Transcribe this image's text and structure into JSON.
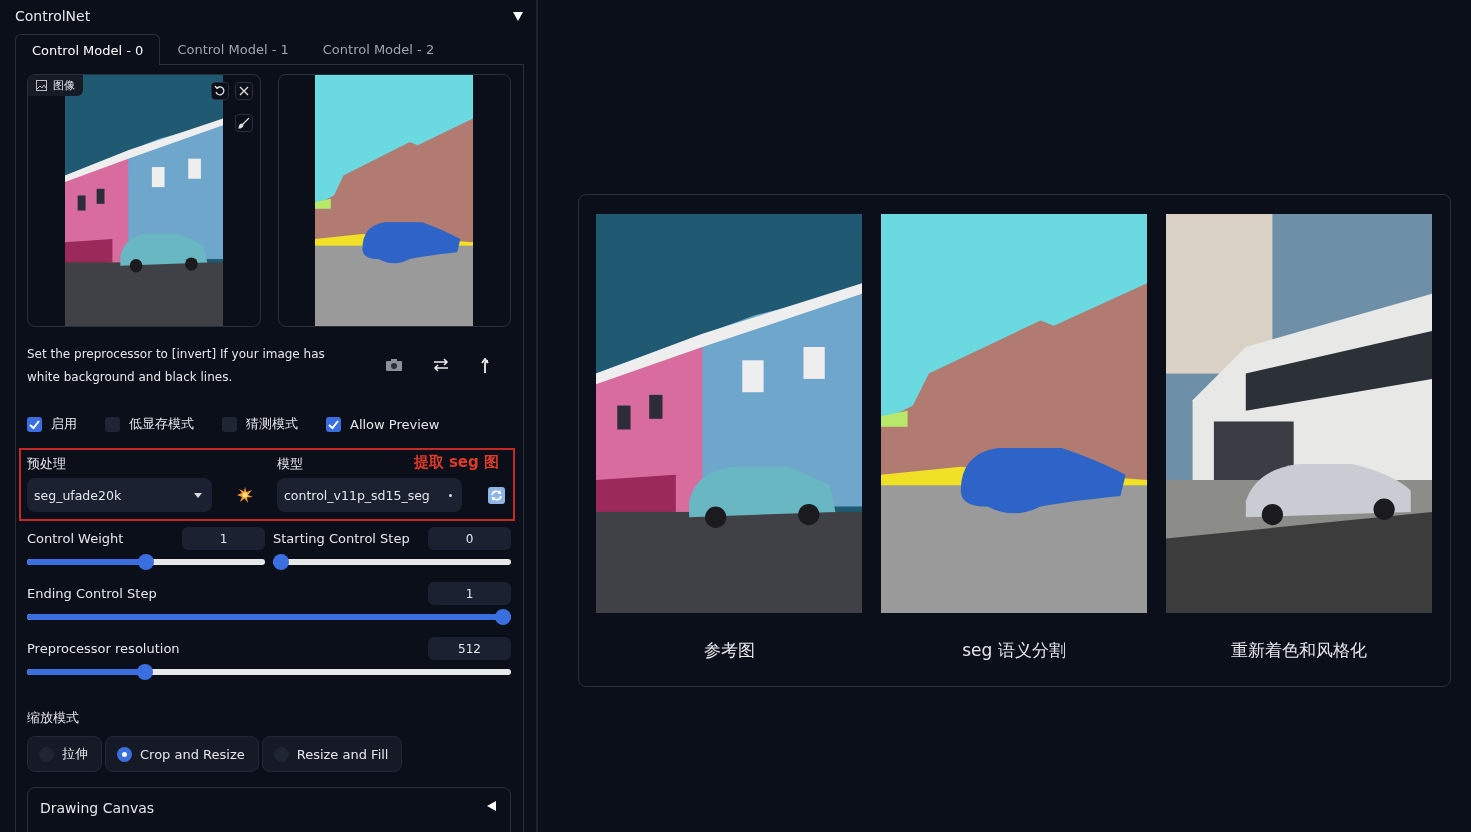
{
  "panel": {
    "title": "ControlNet",
    "expanded": true
  },
  "tabs": [
    {
      "label": "Control Model - 0",
      "selected": true
    },
    {
      "label": "Control Model - 1",
      "selected": false
    },
    {
      "label": "Control Model - 2",
      "selected": false
    }
  ],
  "image_input": {
    "label": "图像"
  },
  "hint": "Set the preprocessor to [invert] If your image has white background and black lines.",
  "checkboxes": [
    {
      "label": "启用",
      "checked": true
    },
    {
      "label": "低显存模式",
      "checked": false
    },
    {
      "label": "猜测模式",
      "checked": false
    },
    {
      "label": "Allow Preview",
      "checked": true
    }
  ],
  "annotation": "提取 seg 图",
  "preprocessor": {
    "label": "预处理",
    "value": "seg_ufade20k"
  },
  "model": {
    "label": "模型",
    "value": "control_v11p_sd15_seg"
  },
  "slider_rows": [
    [
      {
        "label": "Control Weight",
        "value": "1",
        "level": 0.5
      },
      {
        "label": "Starting Control Step",
        "value": "0",
        "level": 0
      }
    ],
    [
      {
        "label": "Ending Control Step",
        "value": "1",
        "level": 1
      }
    ],
    [
      {
        "label": "Preprocessor resolution",
        "value": "512",
        "level": 0.235
      }
    ]
  ],
  "resize_mode": {
    "label": "缩放模式",
    "options": [
      {
        "label": "拉伸",
        "selected": false
      },
      {
        "label": "Crop and Resize",
        "selected": true
      },
      {
        "label": "Resize and Fill",
        "selected": false
      }
    ]
  },
  "drawing_canvas": {
    "title": "Drawing Canvas",
    "expanded": false
  },
  "gallery": [
    {
      "caption": "参考图"
    },
    {
      "kind": "segmentation",
      "caption": "seg 语义分割"
    },
    {
      "kind": "render",
      "caption": "重新着色和风格化"
    }
  ]
}
